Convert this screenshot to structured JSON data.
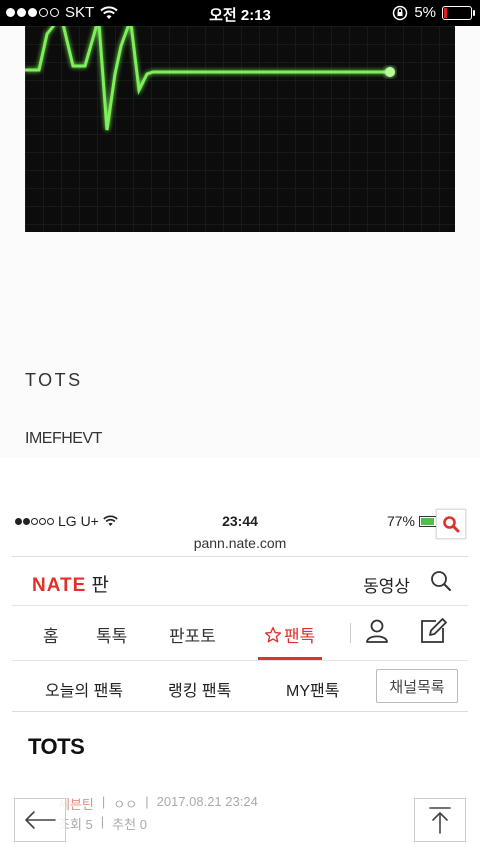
{
  "outer_status": {
    "carrier": "SKT",
    "time": "오전 2:13",
    "battery": "5%",
    "battery_color": "#e02020"
  },
  "article": {
    "image": "heart-monitor-flatline-image",
    "title": "TOTS",
    "subtitle": "IMEFHEVT",
    "line_color": "#7df05a"
  },
  "inner_screenshot": {
    "status": {
      "carrier": "LG U+",
      "time": "23:44",
      "battery": "77%"
    },
    "url": "pann.nate.com",
    "logo": {
      "brand": "NATE",
      "section": "판",
      "brand_color": "#e0322b"
    },
    "video_label": "동영상",
    "tabs": [
      {
        "label": "홈"
      },
      {
        "label": "톡톡"
      },
      {
        "label": "판포토"
      },
      {
        "label": "팬톡",
        "active": true
      }
    ],
    "subtabs": [
      {
        "label": "오늘의 팬톡"
      },
      {
        "label": "랭킹 팬톡"
      },
      {
        "label": "MY팬톡"
      }
    ],
    "channel_button": "채널목록",
    "post": {
      "title": "TOTS",
      "category": "세븐틴",
      "author": "ㅇㅇ",
      "date": "2017.08.21 23:24",
      "views": "조회 5",
      "recommend": "추천 0"
    }
  },
  "floating": {
    "back_icon": "arrow-left-icon",
    "top_icon": "arrow-up-to-top-icon"
  }
}
